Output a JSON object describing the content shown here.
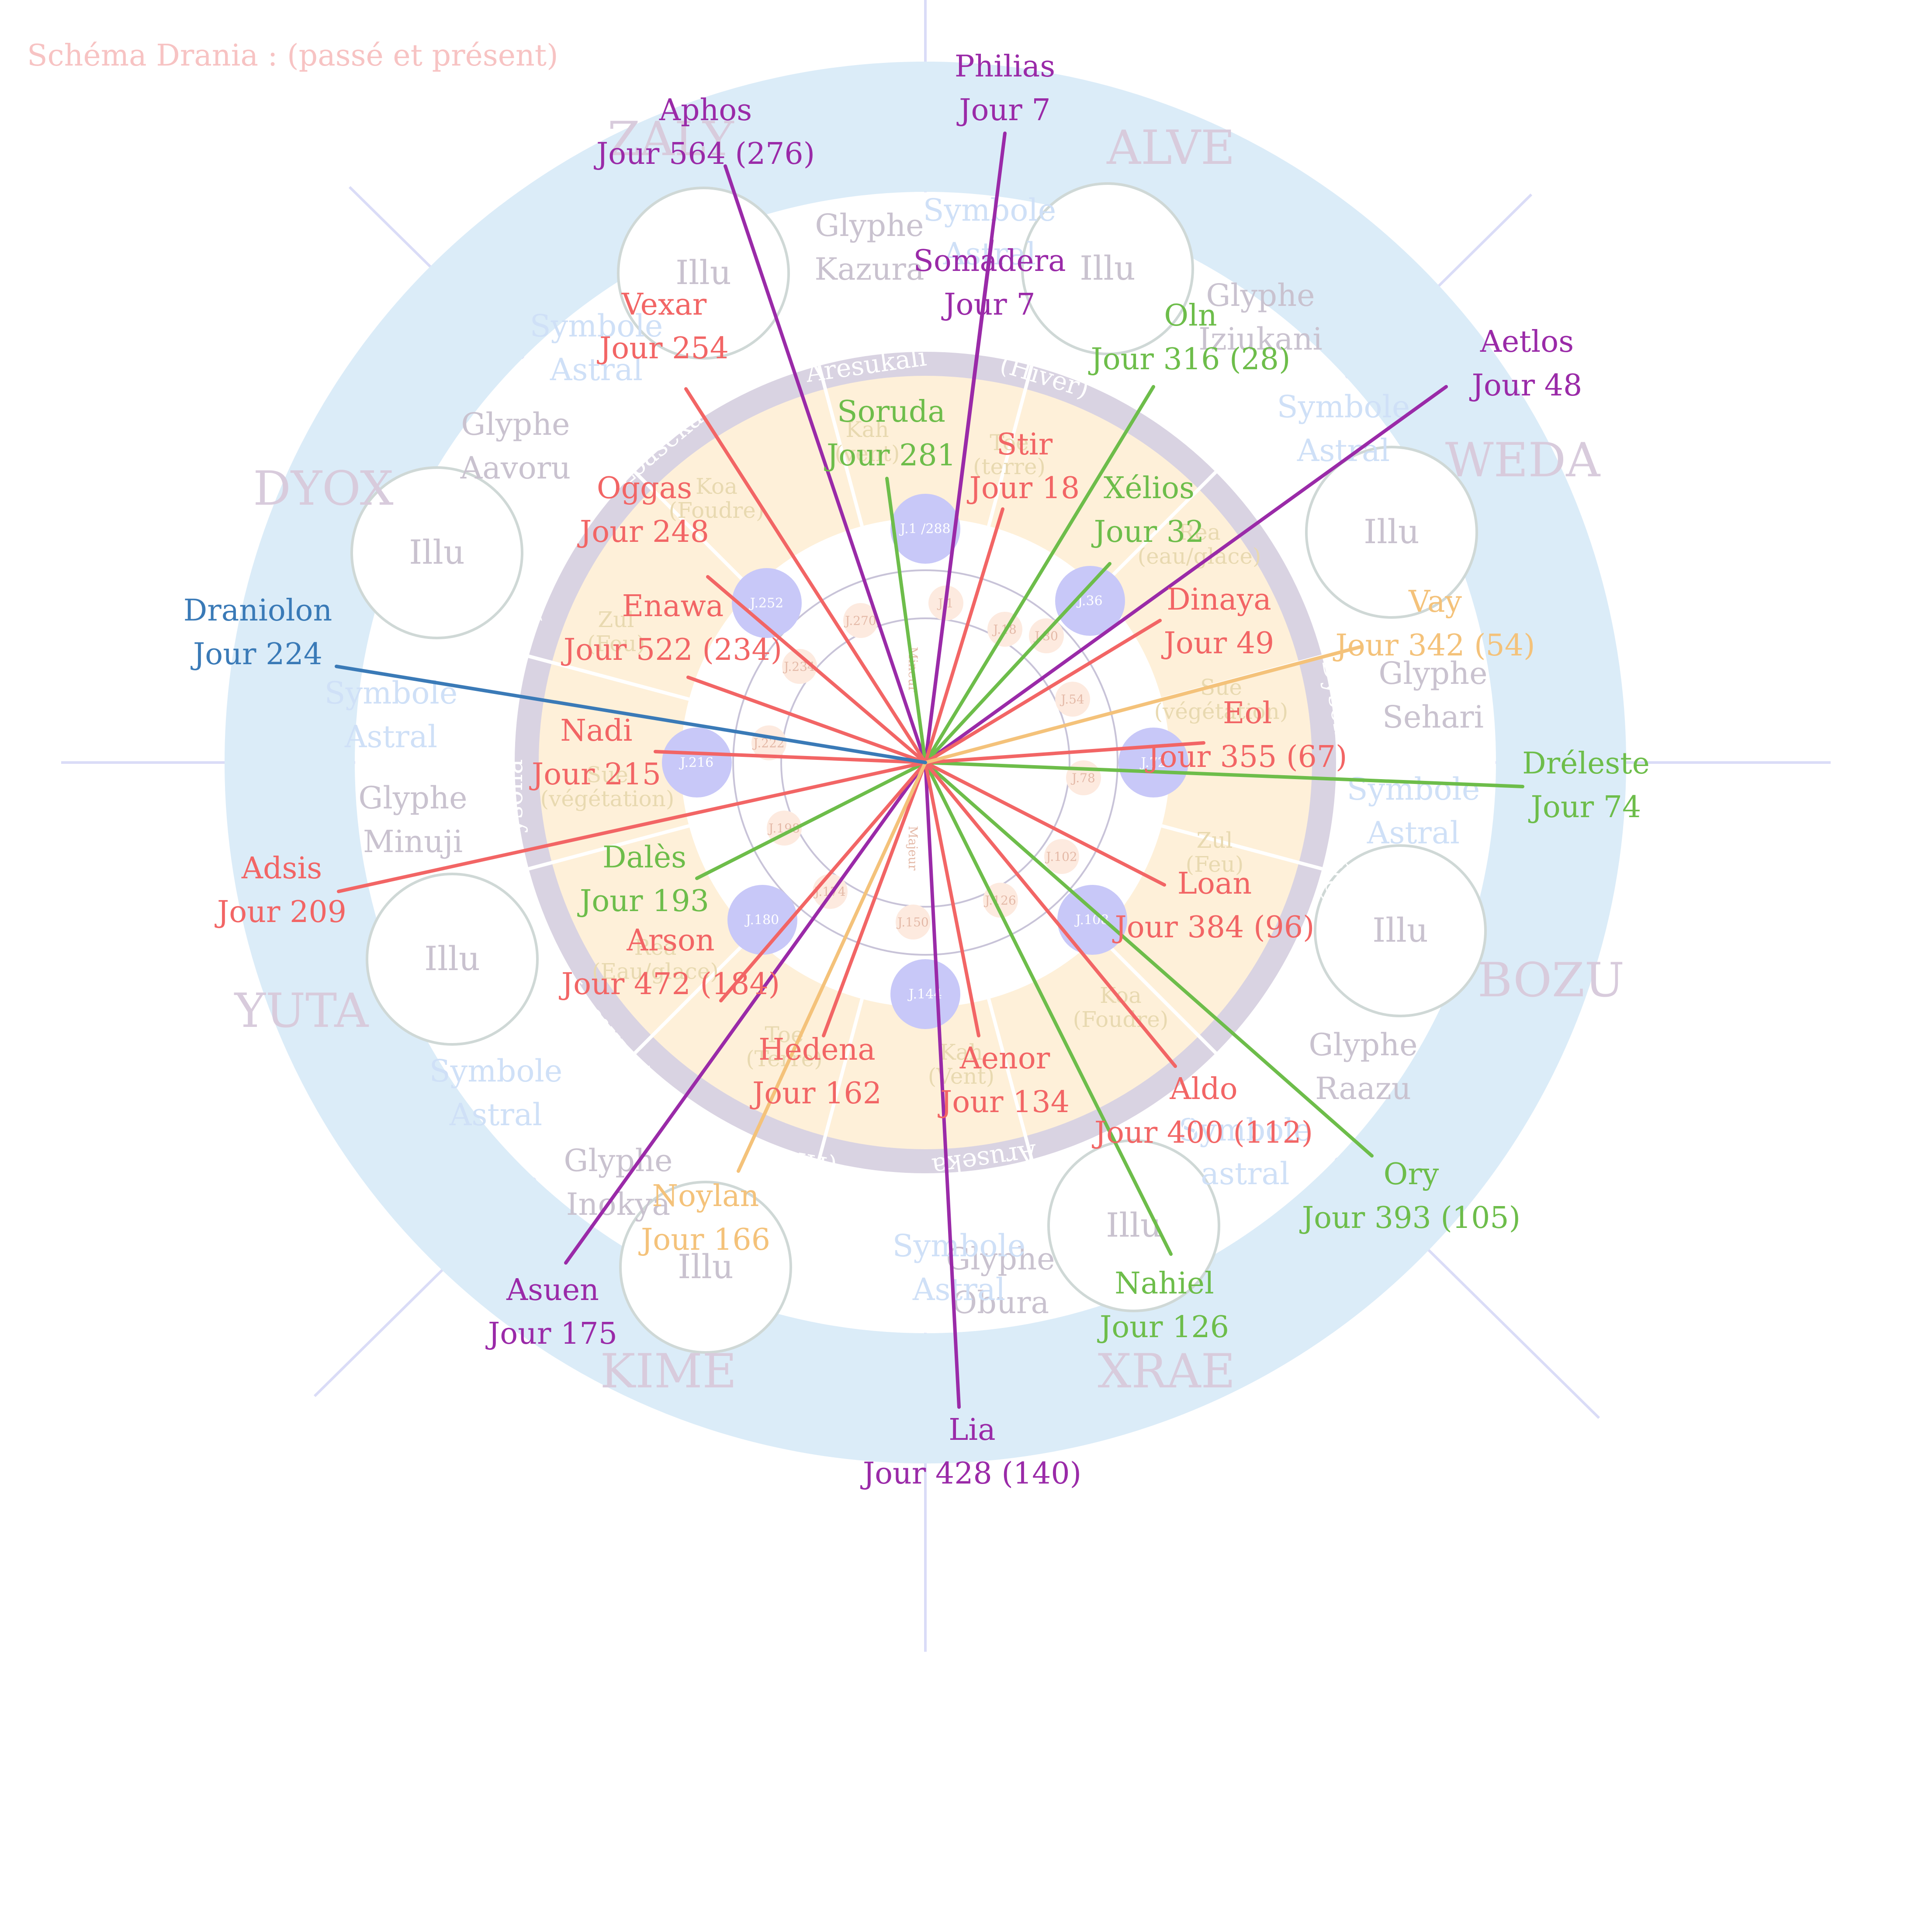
{
  "title": "Schéma Drania : (passé et présent)",
  "colors": {
    "outer_ring": "#dbecf8",
    "season_ring": "#d9d3e2",
    "day_band": "#fef0d9",
    "planet": "#c8c8f8",
    "guide": "#dadcf7",
    "red": "#f26565",
    "green": "#6dbd4a",
    "purple": "#9a2aa8",
    "orange": "#f4c27a",
    "blue": "#3a7ab7"
  },
  "zones": [
    {
      "name": "ZALY"
    },
    {
      "name": "ALVE"
    },
    {
      "name": "WEDA"
    },
    {
      "name": "BOZU"
    },
    {
      "name": "XRAE"
    },
    {
      "name": "KIME"
    },
    {
      "name": "YUTA"
    },
    {
      "name": "DYOX"
    }
  ],
  "illu": [
    "Illu",
    "Illu",
    "Illu",
    "Illu",
    "Illu",
    "Illu",
    "Illu",
    "Illu"
  ],
  "glyphs": [
    {
      "line1": "Glyphe",
      "line2": "Kazura"
    },
    {
      "line1": "Glyphe",
      "line2": "Iziukani"
    },
    {
      "line1": "Glyphe",
      "line2": "Sehari"
    },
    {
      "line1": "Glyphe",
      "line2": "Raazu"
    },
    {
      "line1": "Glyphe",
      "line2": "Obura"
    },
    {
      "line1": "Glyphe",
      "line2": "Inokya"
    },
    {
      "line1": "Glyphe",
      "line2": "Minuji"
    },
    {
      "line1": "Glyphe",
      "line2": "Aavoru"
    }
  ],
  "symbols": [
    {
      "line1": "Symbole",
      "line2": "Astral"
    },
    {
      "line1": "Symbole",
      "line2": "Astral"
    },
    {
      "line1": "Symbole",
      "line2": "Astral"
    },
    {
      "line1": "Symbole",
      "line2": "Astral"
    },
    {
      "line1": "Symbole",
      "line2": "Astral"
    },
    {
      "line1": "Symbole",
      "line2": "Astral"
    },
    {
      "line1": "Symbole",
      "line2": "Astral"
    },
    {
      "line1": "Symbole",
      "line2": "astral"
    },
    {
      "line1": "Symbole Astral",
      "line2": ""
    }
  ],
  "seasons": [
    "Aresukali",
    "(Hiver)",
    "Yuteluna",
    "Dysolia",
    "(été)",
    "(Automne)",
    "Aruseka",
    "(Hiver)",
    "(Printemps)",
    "Dysolia",
    "(été)",
    "Loaseka"
  ],
  "elements": [
    {
      "line1": "Kah",
      "line2": "(vent)"
    },
    {
      "line1": "Toe",
      "line2": "(terre)"
    },
    {
      "line1": "Rea",
      "line2": "(eau/glace)"
    },
    {
      "line1": "Sue",
      "line2": "(végétation)"
    },
    {
      "line1": "Zul",
      "line2": "(Feu)"
    },
    {
      "line1": "Koa",
      "line2": "(Foudre)"
    },
    {
      "line1": "Kah",
      "line2": "(Vent)"
    },
    {
      "line1": "Toe",
      "line2": "(Terre)"
    },
    {
      "line1": "Rea",
      "line2": "(Eau/glace)"
    },
    {
      "line1": "Sue",
      "line2": "(végétation)"
    },
    {
      "line1": "Zul",
      "line2": "(Feu)"
    },
    {
      "line1": "Koa",
      "line2": "(Foudre)"
    }
  ],
  "planet_days": [
    "J.1 /288",
    "J.36",
    "J.72",
    "J.108",
    "J.144",
    "J.180",
    "J.216",
    "J.252"
  ],
  "ring_days": [
    "J.270",
    "J.1",
    "J.18",
    "J.30",
    "J.54",
    "J.78",
    "J.102",
    "J.126",
    "J.150",
    "J.174",
    "J.198",
    "J.222",
    "J.234"
  ],
  "center_text": [
    "Mineur",
    "Majeur"
  ],
  "characters": [
    {
      "name": "Philias",
      "day": "Jour 7",
      "color": "purple"
    },
    {
      "name": "Somadera",
      "day": "Jour 7",
      "color": "purple"
    },
    {
      "name": "Aphos",
      "day": "Jour 564 (276)",
      "color": "purple"
    },
    {
      "name": "Aetlos",
      "day": "Jour 48",
      "color": "purple"
    },
    {
      "name": "Asuen",
      "day": "Jour 175",
      "color": "purple"
    },
    {
      "name": "Lia",
      "day": "Jour 428 (140)",
      "color": "purple"
    },
    {
      "name": "Oln",
      "day": "Jour 316 (28)",
      "color": "green"
    },
    {
      "name": "Soruda",
      "day": "Jour 281",
      "color": "green"
    },
    {
      "name": "Xélios",
      "day": "Jour 32",
      "color": "green"
    },
    {
      "name": "Dréleste",
      "day": "Jour 74",
      "color": "green"
    },
    {
      "name": "Dalès",
      "day": "Jour 193",
      "color": "green"
    },
    {
      "name": "Ory",
      "day": "Jour 393 (105)",
      "color": "green"
    },
    {
      "name": "Nahiel",
      "day": "Jour 126",
      "color": "green"
    },
    {
      "name": "Vexar",
      "day": "Jour 254",
      "color": "red"
    },
    {
      "name": "Oggas",
      "day": "Jour 248",
      "color": "red"
    },
    {
      "name": "Stir",
      "day": "Jour 18",
      "color": "red"
    },
    {
      "name": "Enawa",
      "day": "Jour 522 (234)",
      "color": "red"
    },
    {
      "name": "Dinaya",
      "day": "Jour 49",
      "color": "red"
    },
    {
      "name": "Nadi",
      "day": "Jour 215",
      "color": "red"
    },
    {
      "name": "Eol",
      "day": "Jour 355 (67)",
      "color": "red"
    },
    {
      "name": "Adsis",
      "day": "Jour 209",
      "color": "red"
    },
    {
      "name": "Loan",
      "day": "Jour 384 (96)",
      "color": "red"
    },
    {
      "name": "Arson",
      "day": "Jour 472 (184)",
      "color": "red"
    },
    {
      "name": "Hedena",
      "day": "Jour 162",
      "color": "red"
    },
    {
      "name": "Aenor",
      "day": "Jour 134",
      "color": "red"
    },
    {
      "name": "Aldo",
      "day": "Jour 400 (112)",
      "color": "red"
    },
    {
      "name": "Vay",
      "day": "Jour 342 (54)",
      "color": "orange"
    },
    {
      "name": "Noylan",
      "day": "Jour 166",
      "color": "orange"
    },
    {
      "name": "Draniolon",
      "day": "Jour 224",
      "color": "blue"
    }
  ]
}
